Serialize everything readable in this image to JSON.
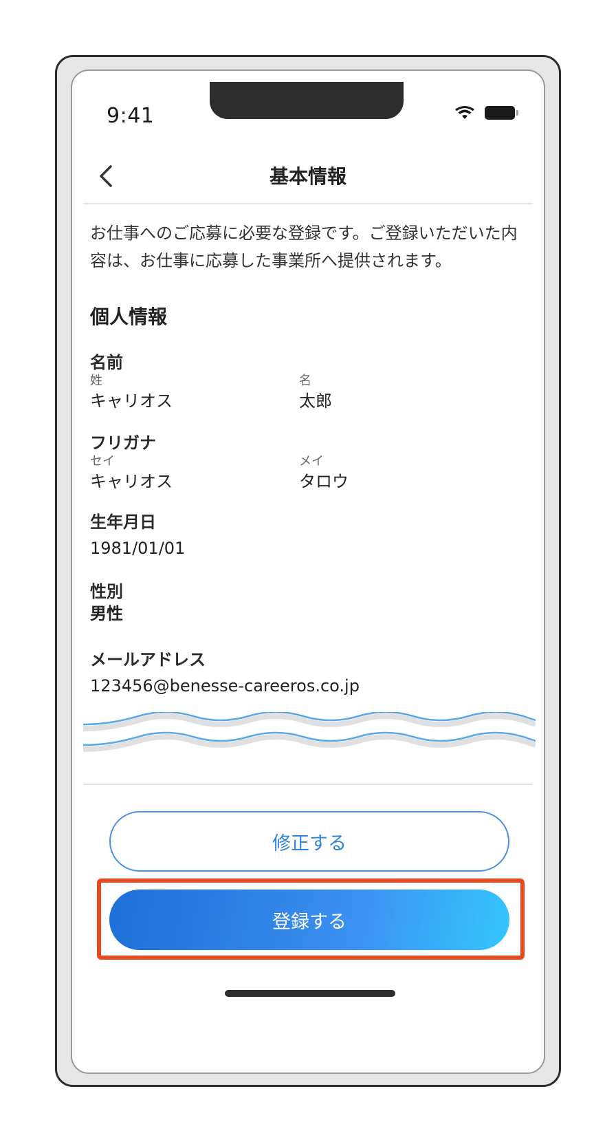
{
  "status_bar": {
    "time": "9:41",
    "wifi_icon": "wifi-icon",
    "battery_icon": "battery-icon"
  },
  "header": {
    "back_icon": "chevron-left-icon",
    "title": "基本情報"
  },
  "intro_text": "お仕事へのご応募に必要な登録です。ご登録いただいた内容は、お仕事に応募した事業所へ提供されます。",
  "personal_info": {
    "title": "個人情報",
    "name": {
      "label": "名前",
      "last_label": "姓",
      "last_value": "キャリオス",
      "first_label": "名",
      "first_value": "太郎"
    },
    "furigana": {
      "label": "フリガナ",
      "last_label": "セイ",
      "last_value": "キャリオス",
      "first_label": "メイ",
      "first_value": "タロウ"
    },
    "birthdate": {
      "label": "生年月日",
      "value": "1981/01/01"
    },
    "gender": {
      "label": "性別",
      "value": "男性"
    },
    "email": {
      "label": "メールアドレス",
      "value": "123456@benesse-careeros.co.jp"
    }
  },
  "buttons": {
    "edit_label": "修正する",
    "register_label": "登録する"
  },
  "colors": {
    "accent": "#2f82de",
    "highlight": "#e8481c"
  }
}
